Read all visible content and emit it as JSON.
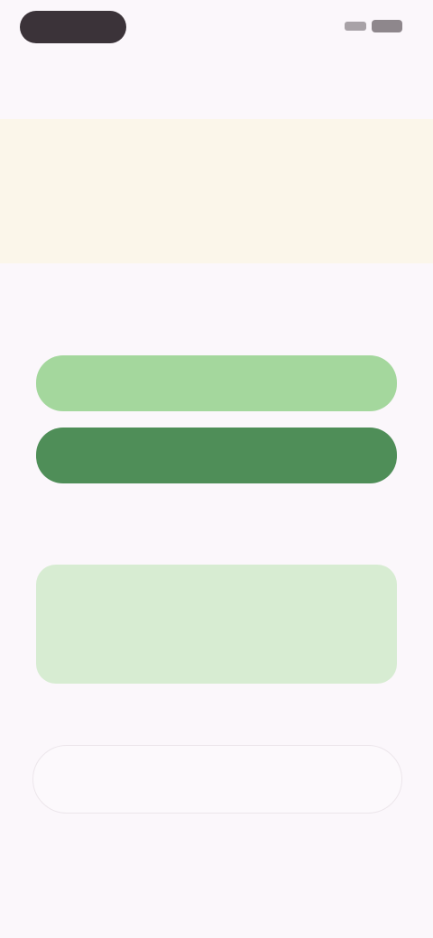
{
  "status_bar": {},
  "nav": {
    "back_label": "",
    "title": ""
  },
  "banner": {
    "text": "",
    "small_text": ""
  },
  "question": {
    "title": ""
  },
  "options": [
    {
      "label": ""
    },
    {
      "label": ""
    }
  ],
  "details": {
    "label": "",
    "text": ""
  },
  "action": {
    "label": ""
  },
  "colors": {
    "background": "#fbf7fb",
    "banner": "#fbf6ea",
    "option_light": "#a4d79d",
    "option_selected": "#4f8e58",
    "card": "#d7ecd2"
  }
}
